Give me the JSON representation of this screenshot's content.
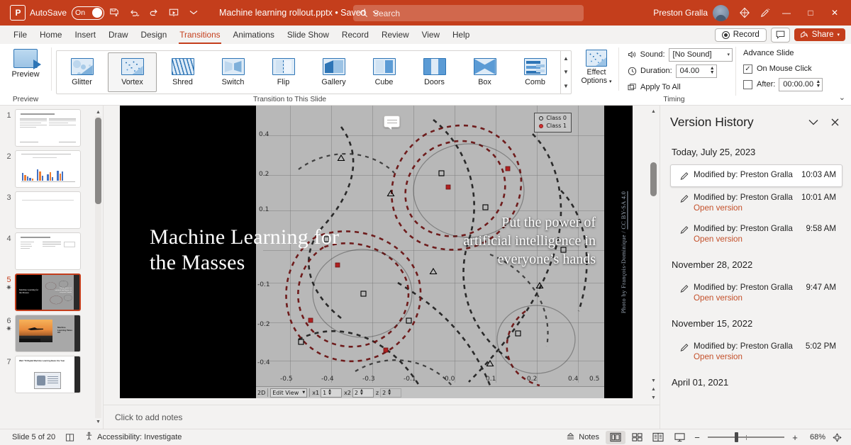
{
  "titlebar": {
    "app_icon": "powerpoint-icon",
    "autosave_label": "AutoSave",
    "autosave_state": "On",
    "filename": "Machine learning rollout.pptx • Saved",
    "search_placeholder": "Search",
    "user_name": "Preston Gralla",
    "minimize": "—",
    "maximize": "□",
    "close": "✕"
  },
  "menu": {
    "tabs": [
      {
        "label": "File",
        "active": false
      },
      {
        "label": "Home",
        "active": false
      },
      {
        "label": "Insert",
        "active": false
      },
      {
        "label": "Draw",
        "active": false
      },
      {
        "label": "Design",
        "active": false
      },
      {
        "label": "Transitions",
        "active": true
      },
      {
        "label": "Animations",
        "active": false
      },
      {
        "label": "Slide Show",
        "active": false
      },
      {
        "label": "Record",
        "active": false
      },
      {
        "label": "Review",
        "active": false
      },
      {
        "label": "View",
        "active": false
      },
      {
        "label": "Help",
        "active": false
      }
    ],
    "record_label": "Record",
    "share_label": "Share"
  },
  "ribbon": {
    "preview": {
      "button_label": "Preview",
      "group_label": "Preview"
    },
    "transitions_group_label": "Transition to This Slide",
    "gallery": [
      {
        "label": "Glitter",
        "selected": false
      },
      {
        "label": "Vortex",
        "selected": true
      },
      {
        "label": "Shred",
        "selected": false
      },
      {
        "label": "Switch",
        "selected": false
      },
      {
        "label": "Flip",
        "selected": false
      },
      {
        "label": "Gallery",
        "selected": false
      },
      {
        "label": "Cube",
        "selected": false
      },
      {
        "label": "Doors",
        "selected": false
      },
      {
        "label": "Box",
        "selected": false
      },
      {
        "label": "Comb",
        "selected": false
      }
    ],
    "effect_options_line1": "Effect",
    "effect_options_line2": "Options",
    "timing": {
      "group_label": "Timing",
      "sound_label": "Sound:",
      "sound_value": "[No Sound]",
      "duration_label": "Duration:",
      "duration_value": "04.00",
      "apply_to_all_label": "Apply To All",
      "advance_slide_label": "Advance Slide",
      "on_mouse_click_label": "On Mouse Click",
      "on_mouse_click_checked": true,
      "after_label": "After:",
      "after_value": "00:00.00",
      "after_checked": false
    }
  },
  "thumbnails": [
    {
      "number": "1",
      "star": false,
      "selected": false,
      "kind": "text"
    },
    {
      "number": "2",
      "star": false,
      "selected": false,
      "kind": "chart"
    },
    {
      "number": "3",
      "star": false,
      "selected": false,
      "kind": "blank"
    },
    {
      "number": "4",
      "star": false,
      "selected": false,
      "kind": "table"
    },
    {
      "number": "5",
      "star": true,
      "selected": true,
      "kind": "title-dark"
    },
    {
      "number": "6",
      "star": true,
      "selected": false,
      "kind": "photo"
    },
    {
      "number": "7",
      "star": false,
      "selected": false,
      "kind": "screenshot"
    }
  ],
  "slide": {
    "title": "Machine Learning for the Masses",
    "subtitle": "Put the power of artificial intelligence in everyone’s hands",
    "credit_prefix": "Photo by François-Dominique / ",
    "credit_link": "CC BY-SA 4.0",
    "legend": [
      "Class 0",
      "Class 1"
    ],
    "y_ticks": [
      "0.4",
      "0.2",
      "0.1",
      "-0.1",
      "-0.2",
      "-0.4"
    ],
    "x_ticks": [
      "-0.5",
      "-0.4",
      "-0.3",
      "-0.1",
      "0.0",
      "0.1",
      "0.2",
      "0.4",
      "0.5"
    ],
    "plot_toolbar": {
      "mode": "2D",
      "view_label": "Edit View",
      "x1_label": "x1",
      "x1_value": "1",
      "x2_label": "x2",
      "x2_value": "2",
      "z_label": "z",
      "z_value": "2"
    }
  },
  "notes": {
    "placeholder": "Click to add notes"
  },
  "version_history": {
    "title": "Version History",
    "groups": [
      {
        "date": "Today, July 25, 2023",
        "items": [
          {
            "modified": "Modified by: Preston Gralla",
            "time": "10:03 AM",
            "open_label": "",
            "selected": true
          },
          {
            "modified": "Modified by: Preston Gralla",
            "time": "10:01 AM",
            "open_label": "Open version",
            "selected": false
          },
          {
            "modified": "Modified by: Preston Gralla",
            "time": "9:58 AM",
            "open_label": "Open version",
            "selected": false
          }
        ]
      },
      {
        "date": "November 28, 2022",
        "items": [
          {
            "modified": "Modified by: Preston Gralla",
            "time": "9:47 AM",
            "open_label": "Open version",
            "selected": false
          }
        ]
      },
      {
        "date": "November 15, 2022",
        "items": [
          {
            "modified": "Modified by: Preston Gralla",
            "time": "5:02 PM",
            "open_label": "Open version",
            "selected": false
          }
        ]
      },
      {
        "date": "April 01, 2021",
        "items": []
      }
    ]
  },
  "statusbar": {
    "slide_counter": "Slide 5 of 20",
    "accessibility": "Accessibility: Investigate",
    "notes_label": "Notes",
    "zoom_percent": "68%"
  }
}
